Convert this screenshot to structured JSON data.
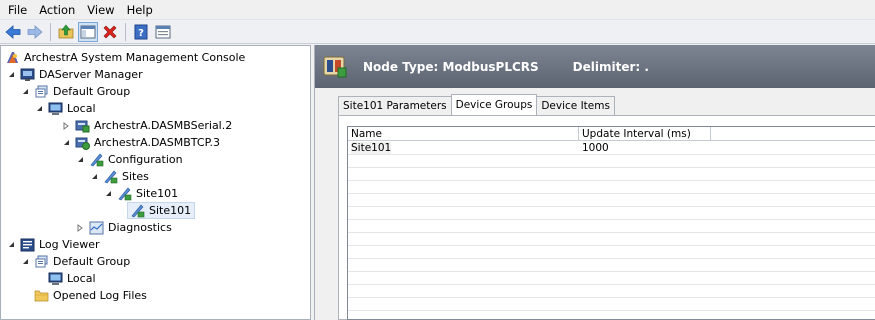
{
  "menu": {
    "file": "File",
    "action": "Action",
    "view": "View",
    "help": "Help"
  },
  "toolbar": {
    "buttons": [
      "back-icon",
      "forward-icon",
      "up-folder-icon",
      "show-hide-tree-icon",
      "delete-icon",
      "help-icon",
      "properties-icon"
    ]
  },
  "tree": {
    "root": "ArchestrA System Management Console",
    "daserver_manager": "DAServer Manager",
    "default_group": "Default Group",
    "local": "Local",
    "dasmbserial": "ArchestrA.DASMBSerial.2",
    "dasmbtcp": "ArchestrA.DASMBTCP.3",
    "configuration": "Configuration",
    "sites": "Sites",
    "site101": "Site101",
    "site101_child": "Site101",
    "diagnostics": "Diagnostics",
    "log_viewer": "Log Viewer",
    "log_default_group": "Default Group",
    "log_local": "Local",
    "opened_log_files": "Opened Log Files"
  },
  "header": {
    "node_type": "Node Type: ModbusPLCRS",
    "delimiter": "Delimiter:  ."
  },
  "tabs": {
    "site_params": "Site101 Parameters",
    "device_groups": "Device Groups",
    "device_items": "Device Items",
    "active": "Device Groups"
  },
  "grid": {
    "columns": [
      "Name",
      "Update Interval (ms)"
    ],
    "rows": [
      {
        "name": "Site101",
        "interval": "1000"
      }
    ]
  },
  "colors": {
    "header_bg": "#6b7280",
    "selection": "#e5eef9"
  }
}
